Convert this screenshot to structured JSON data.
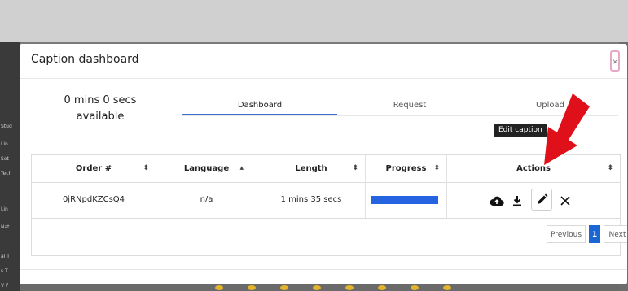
{
  "background": {
    "sidebar_snippets": [
      "Stud",
      "Lin",
      "Set",
      "Tech",
      "Lin",
      "Nat",
      "al T",
      "s T",
      "V F"
    ]
  },
  "modal": {
    "title": "Caption dashboard",
    "close_label": "×",
    "availability": "0 mins 0 secs available",
    "tabs": [
      {
        "label": "Dashboard",
        "active": true
      },
      {
        "label": "Request",
        "active": false
      },
      {
        "label": "Upload",
        "active": false
      }
    ],
    "table": {
      "columns": [
        {
          "label": "Order #",
          "sort": "⬍"
        },
        {
          "label": "Language",
          "sort": "▴"
        },
        {
          "label": "Length",
          "sort": "⬍"
        },
        {
          "label": "Progress",
          "sort": "⬍"
        },
        {
          "label": "Actions",
          "sort": "⬍"
        }
      ],
      "rows": [
        {
          "order": "0jRNpdKZCsQ4",
          "language": "n/a",
          "length": "1 mins 35 secs",
          "progress": 1.0
        }
      ],
      "actions": {
        "upload_icon": "cloud-upload-icon",
        "download_icon": "download-icon",
        "edit_icon": "pencil-icon",
        "delete_icon": "close-icon"
      },
      "tooltip": "Edit caption"
    },
    "pagination": {
      "previous": "Previous",
      "current": "1",
      "next": "Next"
    }
  },
  "colors": {
    "accent": "#2563e0",
    "arrow": "#e0101a",
    "close_border": "#e7a8c8"
  }
}
